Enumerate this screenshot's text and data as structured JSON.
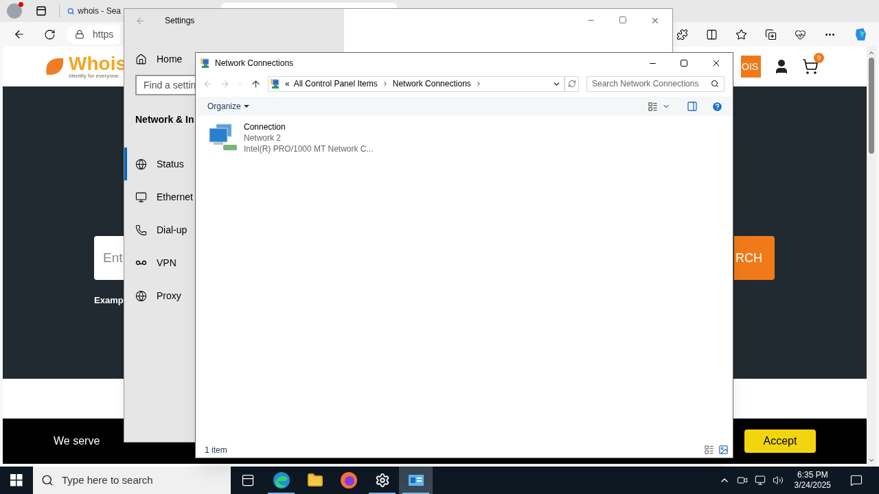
{
  "browser": {
    "tabs": [
      {
        "label": "whois - Sea",
        "selected": false
      },
      {
        "selected": true
      }
    ],
    "address": "https"
  },
  "page": {
    "logo": "Whois",
    "tagline": "Identity for everyone",
    "header_button": "OIS",
    "cart_count": "0",
    "search_placeholder": "Ent",
    "search_button": "RCH",
    "example": "Examp",
    "cookie_text": "We serve",
    "accept": "Accept"
  },
  "settings": {
    "title": "Settings",
    "home": "Home",
    "search_placeholder": "Find a settin",
    "section": "Network & In",
    "items": [
      {
        "label": "Status",
        "kind": "status",
        "selected": true
      },
      {
        "label": "Ethernet",
        "kind": "ethernet",
        "selected": false
      },
      {
        "label": "Dial-up",
        "kind": "dialup",
        "selected": false
      },
      {
        "label": "VPN",
        "kind": "vpn",
        "selected": false
      },
      {
        "label": "Proxy",
        "kind": "proxy",
        "selected": false
      }
    ]
  },
  "network": {
    "title": "Network Connections",
    "overflow": "«",
    "breadcrumb": [
      "All Control Panel Items",
      "Network Connections"
    ],
    "search_placeholder": "Search Network Connections",
    "organize": "Organize",
    "items": [
      {
        "name": "Connection",
        "network": "Network 2",
        "adapter": "Intel(R) PRO/1000 MT Network C..."
      }
    ],
    "status": "1 item"
  },
  "taskbar": {
    "search_placeholder": "Type here to search",
    "apps": [
      {
        "kind": "taskview",
        "running": false,
        "active": false
      },
      {
        "kind": "edge",
        "running": true,
        "active": false
      },
      {
        "kind": "explorer",
        "running": false,
        "active": false
      },
      {
        "kind": "firefox",
        "running": false,
        "active": false
      },
      {
        "kind": "settings",
        "running": true,
        "active": false
      },
      {
        "kind": "netconn",
        "running": true,
        "active": true
      }
    ],
    "time": "6:35 PM",
    "date": "3/24/2025"
  }
}
